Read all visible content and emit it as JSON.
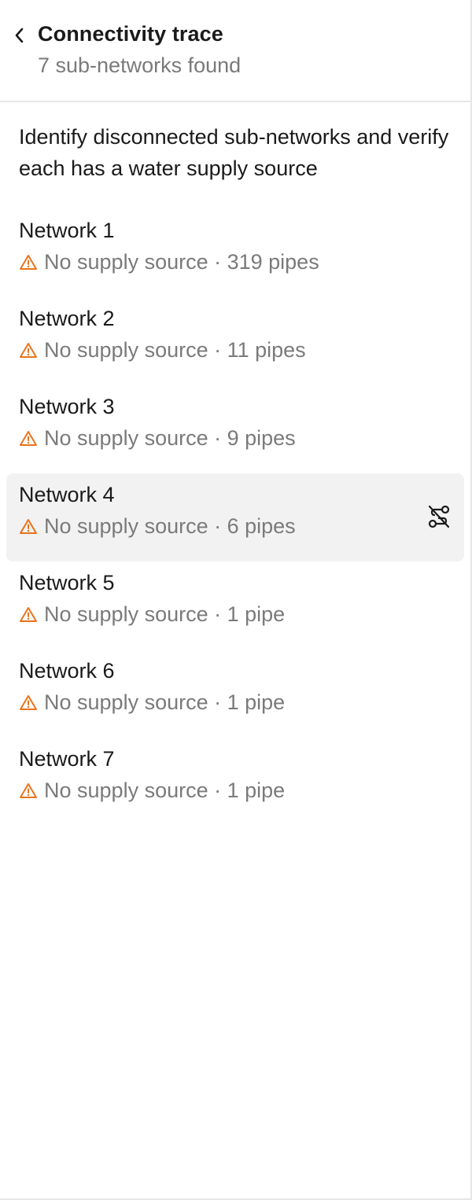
{
  "header": {
    "title": "Connectivity trace",
    "subtitle": "7 sub-networks found"
  },
  "description": "Identify disconnected sub-networks and verify each has a water supply source",
  "colors": {
    "warning": "#e8731c",
    "muted_text": "#7a7a7a",
    "selected_bg": "#f2f2f2"
  },
  "networks": [
    {
      "name": "Network 1",
      "status": "No supply source · 319 pipes"
    },
    {
      "name": "Network 2",
      "status": "No supply source · 11 pipes"
    },
    {
      "name": "Network 3",
      "status": "No supply source · 9 pipes"
    },
    {
      "name": "Network 4",
      "status": "No supply source · 6 pipes",
      "selected": true,
      "action_icon": "route-off-icon"
    },
    {
      "name": "Network 5",
      "status": "No supply source · 1 pipe"
    },
    {
      "name": "Network 6",
      "status": "No supply source · 1 pipe"
    },
    {
      "name": "Network 7",
      "status": "No supply source · 1 pipe"
    }
  ]
}
